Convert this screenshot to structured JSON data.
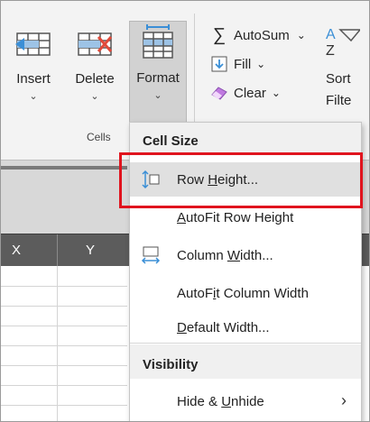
{
  "ribbon": {
    "cells_group": {
      "insert_label": "Insert",
      "delete_label": "Delete",
      "format_label": "Format",
      "group_label": "Cells"
    },
    "editing": {
      "autosum_label": "AutoSum",
      "fill_label": "Fill",
      "clear_label": "Clear",
      "sort_label_1": "Sort",
      "sort_label_2": "Filte"
    }
  },
  "column_headers": [
    "X",
    "Y"
  ],
  "menu": {
    "section_cell_size": "Cell Size",
    "items": [
      {
        "pre": "Row ",
        "accel": "H",
        "post": "eight..."
      },
      {
        "pre": "",
        "accel": "A",
        "post": "utoFit Row Height"
      },
      {
        "pre": "Column ",
        "accel": "W",
        "post": "idth..."
      },
      {
        "pre": "AutoF",
        "accel": "i",
        "post": "t Column Width"
      },
      {
        "pre": "",
        "accel": "D",
        "post": "efault Width..."
      }
    ],
    "section_visibility": "Visibility",
    "hide_unhide": {
      "pre": "Hide & ",
      "accel": "U",
      "post": "nhide"
    }
  },
  "colors": {
    "highlight": "#e0141e",
    "ribbon_bg": "#f3f3f3",
    "menu_hover": "#e0e0e0"
  }
}
